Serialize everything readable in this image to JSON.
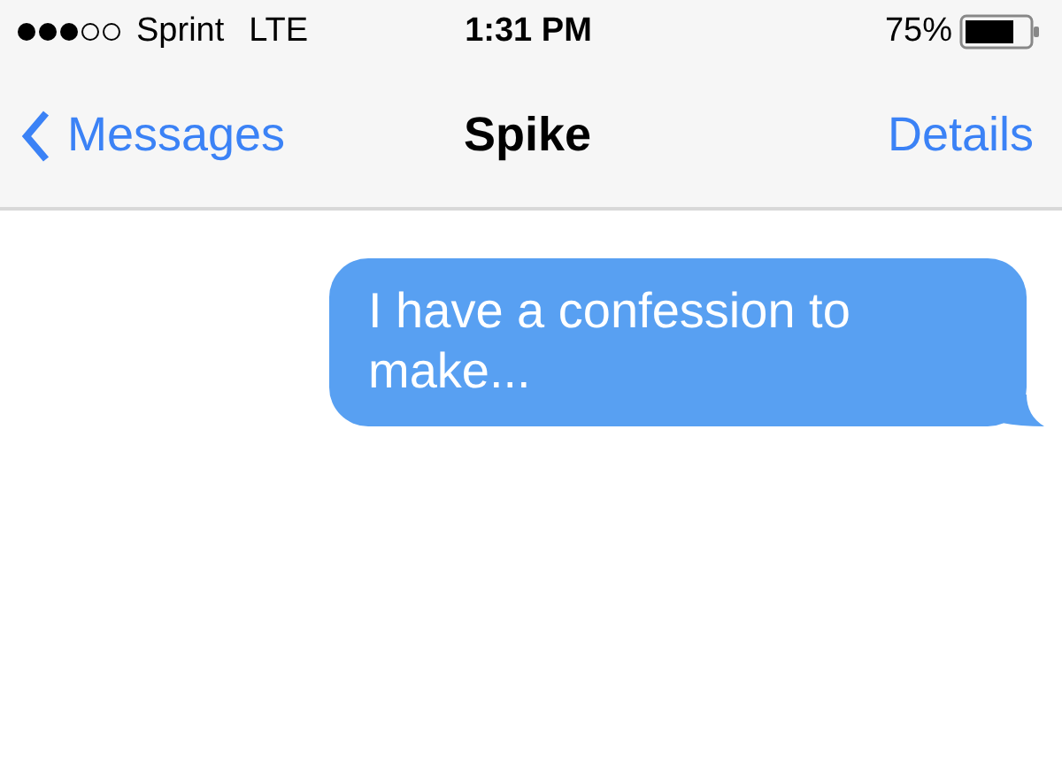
{
  "status_bar": {
    "carrier": "Sprint",
    "network": "LTE",
    "time": "1:31 PM",
    "battery": "75%"
  },
  "nav_bar": {
    "back": "Messages",
    "title": "Spike",
    "action": "Details"
  },
  "messages": [
    {
      "text": "I have a confession to make...",
      "outgoing": true
    }
  ]
}
